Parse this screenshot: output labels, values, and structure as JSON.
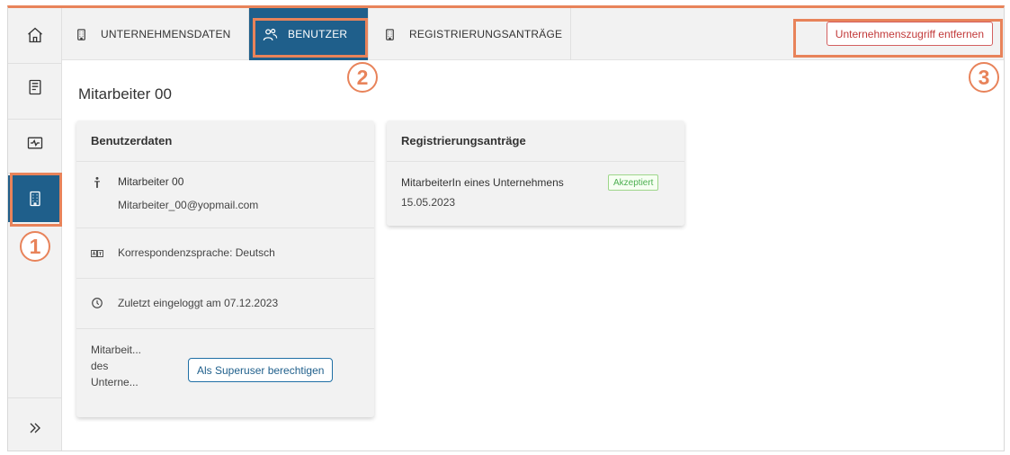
{
  "tabs": [
    {
      "label": "UNTERNEHMENSDATEN",
      "icon": "building-icon"
    },
    {
      "label": "BENUTZER",
      "icon": "users-icon",
      "active": true
    },
    {
      "label": "REGISTRIERUNGSANTRÄGE",
      "icon": "building-icon"
    }
  ],
  "header": {
    "remove_access_label": "Unternehmenszugriff entfernen"
  },
  "sidebar": {
    "items": [
      {
        "icon": "home-icon"
      },
      {
        "icon": "book-icon"
      },
      {
        "icon": "activity-icon"
      },
      {
        "icon": "building-icon",
        "active": true
      },
      {
        "icon": "chevrons-right-icon"
      }
    ]
  },
  "callouts": [
    "1",
    "2",
    "3"
  ],
  "page": {
    "title": "Mitarbeiter 00"
  },
  "user_card": {
    "title": "Benutzerdaten",
    "name": "Mitarbeiter 00",
    "email": "Mitarbeiter_00@yopmail.com",
    "language": "Korrespondenzsprache: Deutsch",
    "last_login": "Zuletzt eingeloggt am 07.12.2023",
    "role_lines": [
      "Mitarbeit...",
      "des",
      "Unterne..."
    ],
    "superuser_button": "Als Superuser berechtigen"
  },
  "registration_card": {
    "title": "Registrierungsanträge",
    "request_type": "MitarbeiterIn eines Unternehmens",
    "status": "Akzeptiert",
    "date": "15.05.2023"
  },
  "colors": {
    "primary": "#1f5f8b",
    "callout": "#e8835a",
    "danger": "#c23a3a",
    "success": "#4caf50"
  }
}
